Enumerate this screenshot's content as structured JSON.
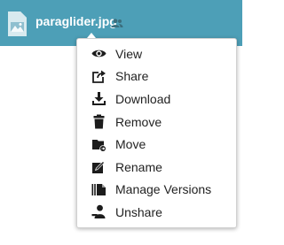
{
  "file": {
    "name": "paraglider.jpg",
    "icon": "image-file-icon",
    "shared_icon": "shared-users-icon"
  },
  "colors": {
    "header_background": "#4d9fb7",
    "menu_text": "#222222",
    "icon_color": "#1c1c1c"
  },
  "menu": {
    "items": [
      {
        "label": "View",
        "icon": "eye-icon"
      },
      {
        "label": "Share",
        "icon": "share-icon"
      },
      {
        "label": "Download",
        "icon": "download-icon"
      },
      {
        "label": "Remove",
        "icon": "trash-icon"
      },
      {
        "label": "Move",
        "icon": "move-folder-icon"
      },
      {
        "label": "Rename",
        "icon": "rename-icon"
      },
      {
        "label": "Manage Versions",
        "icon": "versions-icon"
      },
      {
        "label": "Unshare",
        "icon": "unshare-icon"
      }
    ]
  }
}
